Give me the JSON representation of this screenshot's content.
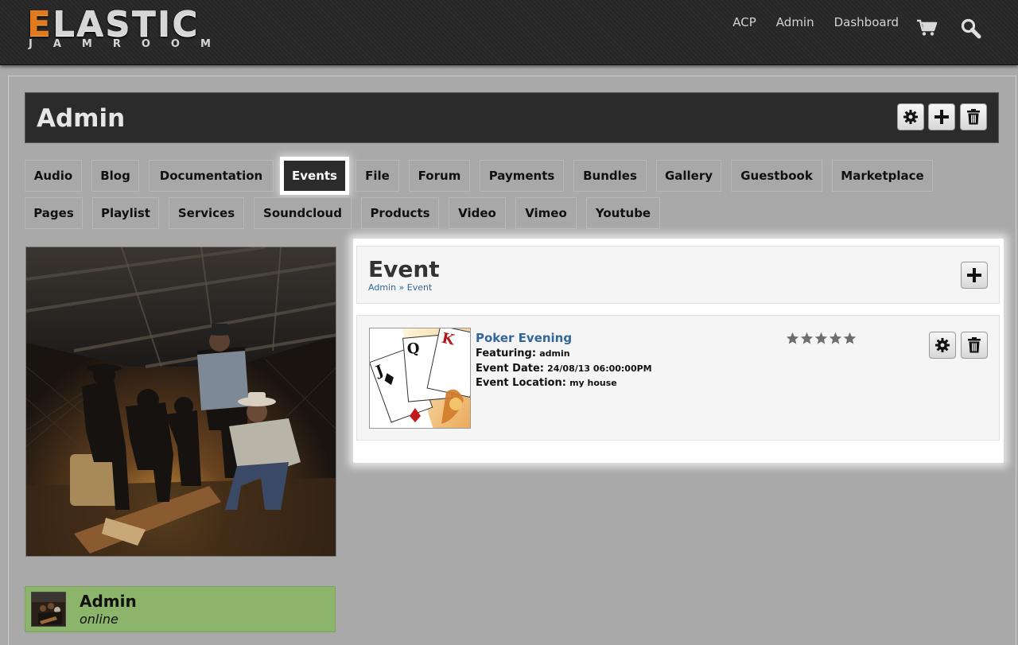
{
  "header": {
    "logo_main_first": "E",
    "logo_main_rest": "LASTIC",
    "logo_sub": "JAMROOM",
    "nav": [
      "ACP",
      "Admin",
      "Dashboard"
    ],
    "icons": [
      "cart-icon",
      "search-icon"
    ]
  },
  "profile": {
    "title": "Admin",
    "buttons": [
      "gear-icon",
      "plus-icon",
      "trash-icon"
    ]
  },
  "tabs": {
    "row1": [
      "Audio",
      "Blog",
      "Documentation",
      "Events",
      "File",
      "Forum",
      "Payments",
      "Bundles",
      "Gallery",
      "Guestbook",
      "Marketplace"
    ],
    "row2": [
      "Pages",
      "Playlist",
      "Services",
      "Soundcloud",
      "Products",
      "Video",
      "Vimeo",
      "Youtube"
    ],
    "active": "Events"
  },
  "event_section": {
    "title": "Event",
    "breadcrumb": {
      "home": "Admin",
      "separator": " » ",
      "current": "Event"
    },
    "item": {
      "title": "Poker Evening",
      "featuring_label": "Featuring:",
      "featuring_value": "admin",
      "date_label": "Event Date:",
      "date_value": "24/08/13 06:00:00PM",
      "location_label": "Event Location:",
      "location_value": "my house",
      "rating": 0,
      "rating_max": 5
    }
  },
  "user_card": {
    "name": "Admin",
    "status": "online"
  },
  "colors": {
    "accent_link": "#336699",
    "online_card": "#8cb46a",
    "logo_orange": "#e07a1c"
  }
}
